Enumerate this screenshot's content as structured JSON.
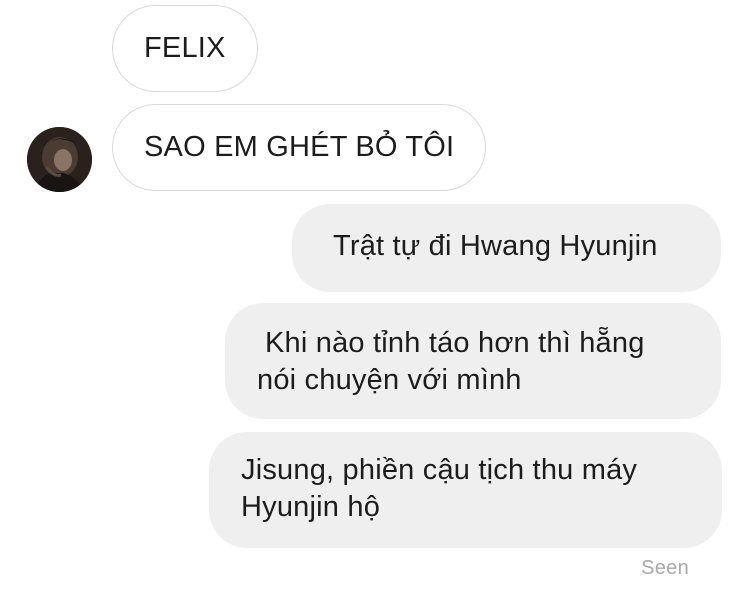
{
  "messages": [
    {
      "id": "m1",
      "sender": "incoming",
      "text": "FELIX"
    },
    {
      "id": "m2",
      "sender": "incoming",
      "text": "SAO EM GHÉT BỎ TÔI"
    },
    {
      "id": "m3",
      "sender": "outgoing",
      "text": "Trật tự đi Hwang Hyunjin"
    },
    {
      "id": "m4",
      "sender": "outgoing",
      "lines": [
        "Khi nào tỉnh táo hơn thì hẵng",
        "nói chuyện với mình"
      ]
    },
    {
      "id": "m5",
      "sender": "outgoing",
      "lines": [
        "Jisung, phiền cậu tịch thu máy",
        "Hyunjin hộ"
      ]
    }
  ],
  "status": {
    "seen_label": "Seen"
  },
  "colors": {
    "outgoing_bubble": "#efefef",
    "incoming_border": "#d9d9d9",
    "seen_text": "#a9a9a9"
  },
  "icons": {
    "avatar": "contact-avatar"
  }
}
